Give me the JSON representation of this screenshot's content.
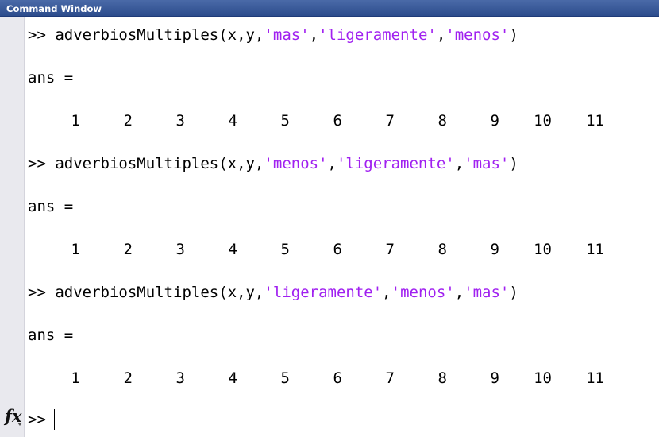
{
  "window": {
    "title": "Command Window"
  },
  "prompt": ">>",
  "commands": [
    {
      "prefix": "adverbiosMultiples(x,y,",
      "args": [
        "'mas'",
        "'ligeramente'",
        "'menos'"
      ],
      "close": ")",
      "ans_label": "ans =",
      "values": [
        "1",
        "2",
        "3",
        "4",
        "5",
        "6",
        "7",
        "8",
        "9",
        "10",
        "11"
      ]
    },
    {
      "prefix": "adverbiosMultiples(x,y,",
      "args": [
        "'menos'",
        "'ligeramente'",
        "'mas'"
      ],
      "close": ")",
      "ans_label": "ans =",
      "values": [
        "1",
        "2",
        "3",
        "4",
        "5",
        "6",
        "7",
        "8",
        "9",
        "10",
        "11"
      ]
    },
    {
      "prefix": "adverbiosMultiples(x,y,",
      "args": [
        "'ligeramente'",
        "'menos'",
        "'mas'"
      ],
      "close": ")",
      "ans_label": "ans =",
      "values": [
        "1",
        "2",
        "3",
        "4",
        "5",
        "6",
        "7",
        "8",
        "9",
        "10",
        "11"
      ]
    }
  ],
  "icons": {
    "function_browser": "fx-icon"
  },
  "colors": {
    "string": "#a020f0",
    "titlebar": "#2c4c8c"
  }
}
